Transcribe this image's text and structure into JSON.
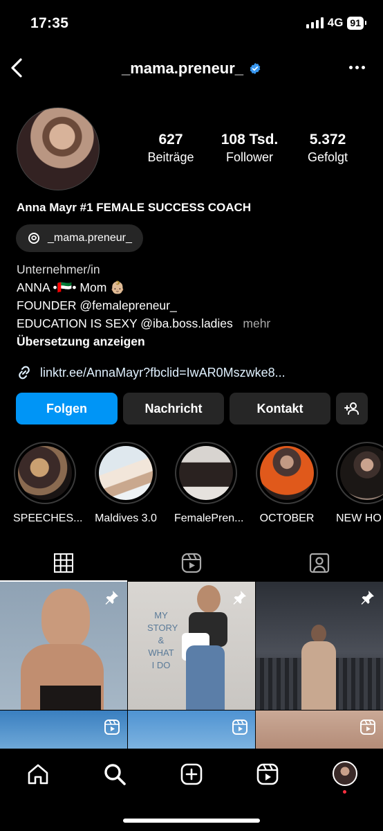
{
  "status": {
    "time": "17:35",
    "network": "4G",
    "battery": "91"
  },
  "header": {
    "username": "_mama.preneur_",
    "back_icon": "chevron-left-icon",
    "more_icon": "more-horizontal-icon",
    "verified_color": "#3897f0"
  },
  "profile": {
    "stats": [
      {
        "value": "627",
        "label": "Beiträge"
      },
      {
        "value": "108 Tsd.",
        "label": "Follower"
      },
      {
        "value": "5.372",
        "label": "Gefolgt"
      }
    ],
    "full_name": "Anna Mayr #1 FEMALE SUCCESS COACH",
    "threads_handle": "_mama.preneur_",
    "bio": {
      "line1": "Unternehmer/in",
      "line2": "ANNA •🇦🇪• Mom 👶🏼",
      "line3": "FOUNDER @femalepreneur_",
      "line4": "EDUCATION IS SEXY @iba.boss.ladies",
      "more": "mehr",
      "translate": "Übersetzung anzeigen"
    },
    "link": "linktr.ee/AnnaMayr?fbclid=IwAR0Mszwke8..."
  },
  "actions": {
    "follow": "Folgen",
    "message": "Nachricht",
    "contact": "Kontakt",
    "follow_color": "#0095f6"
  },
  "highlights": [
    {
      "label": "SPEECHES..."
    },
    {
      "label": "Maldives 3.0"
    },
    {
      "label": "FemalePren..."
    },
    {
      "label": "OCTOBER"
    },
    {
      "label": "NEW HO"
    }
  ],
  "tabs": [
    "grid-icon",
    "reels-icon",
    "tagged-icon"
  ],
  "posts": {
    "story_text": "MY STORY & WHAT I DO"
  },
  "nav": [
    "home-icon",
    "search-icon",
    "create-icon",
    "reels-icon",
    "profile-avatar"
  ]
}
